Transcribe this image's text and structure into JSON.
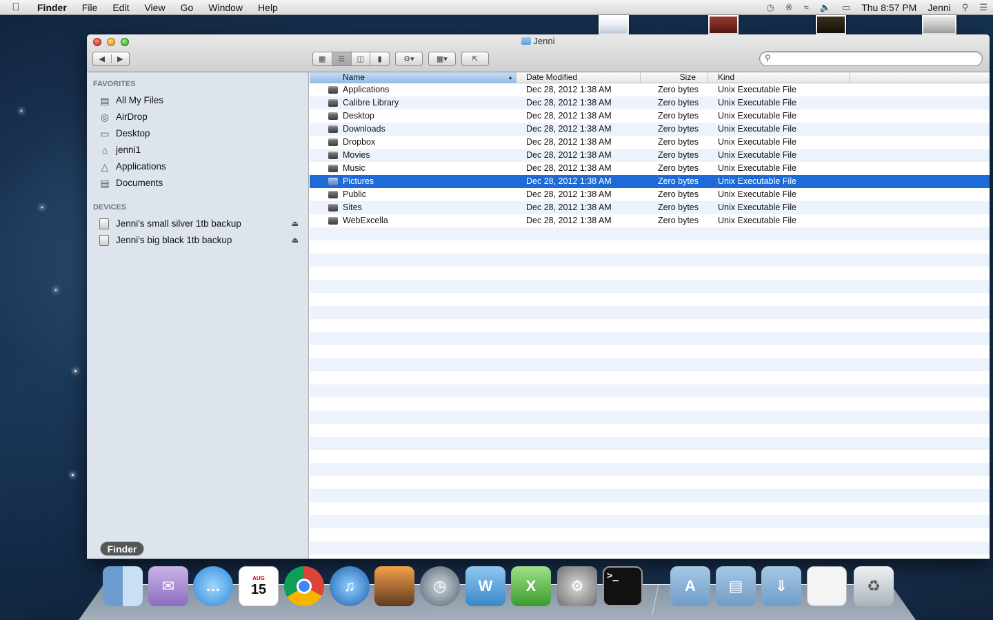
{
  "menubar": {
    "app_name": "Finder",
    "items": [
      "File",
      "Edit",
      "View",
      "Go",
      "Window",
      "Help"
    ],
    "clock": "Thu 8:57 PM",
    "user": "Jenni"
  },
  "window": {
    "title": "Jenni"
  },
  "search": {
    "value": "",
    "placeholder": ""
  },
  "sidebar": {
    "favorites_header": "FAVORITES",
    "favorites": [
      {
        "label": "All My Files",
        "icon": "all-files-icon"
      },
      {
        "label": "AirDrop",
        "icon": "airdrop-icon"
      },
      {
        "label": "Desktop",
        "icon": "desktop-icon"
      },
      {
        "label": "jenni1",
        "icon": "home-icon"
      },
      {
        "label": "Applications",
        "icon": "applications-icon"
      },
      {
        "label": "Documents",
        "icon": "documents-icon"
      }
    ],
    "devices_header": "DEVICES",
    "devices": [
      {
        "label": "Jenni's small silver 1tb backup",
        "icon": "drive-icon"
      },
      {
        "label": "Jenni's big black 1tb backup",
        "icon": "drive-icon"
      }
    ]
  },
  "columns": {
    "name": "Name",
    "date": "Date Modified",
    "size": "Size",
    "kind": "Kind"
  },
  "files": [
    {
      "name": "Applications",
      "date": "Dec 28, 2012 1:38 AM",
      "size": "Zero bytes",
      "kind": "Unix Executable File"
    },
    {
      "name": "Calibre Library",
      "date": "Dec 28, 2012 1:38 AM",
      "size": "Zero bytes",
      "kind": "Unix Executable File"
    },
    {
      "name": "Desktop",
      "date": "Dec 28, 2012 1:38 AM",
      "size": "Zero bytes",
      "kind": "Unix Executable File"
    },
    {
      "name": "Downloads",
      "date": "Dec 28, 2012 1:38 AM",
      "size": "Zero bytes",
      "kind": "Unix Executable File"
    },
    {
      "name": "Dropbox",
      "date": "Dec 28, 2012 1:38 AM",
      "size": "Zero bytes",
      "kind": "Unix Executable File"
    },
    {
      "name": "Movies",
      "date": "Dec 28, 2012 1:38 AM",
      "size": "Zero bytes",
      "kind": "Unix Executable File"
    },
    {
      "name": "Music",
      "date": "Dec 28, 2012 1:38 AM",
      "size": "Zero bytes",
      "kind": "Unix Executable File"
    },
    {
      "name": "Pictures",
      "date": "Dec 28, 2012 1:38 AM",
      "size": "Zero bytes",
      "kind": "Unix Executable File",
      "selected": true
    },
    {
      "name": "Public",
      "date": "Dec 28, 2012 1:38 AM",
      "size": "Zero bytes",
      "kind": "Unix Executable File"
    },
    {
      "name": "Sites",
      "date": "Dec 28, 2012 1:38 AM",
      "size": "Zero bytes",
      "kind": "Unix Executable File"
    },
    {
      "name": "WebExcella",
      "date": "Dec 28, 2012 1:38 AM",
      "size": "Zero bytes",
      "kind": "Unix Executable File"
    }
  ],
  "dock": {
    "tooltip": "Finder",
    "calendar_month": "AUG",
    "calendar_day": "15",
    "colors": {
      "selection": "#1e6ad6",
      "sidebar_bg": "#dde4ec"
    }
  }
}
